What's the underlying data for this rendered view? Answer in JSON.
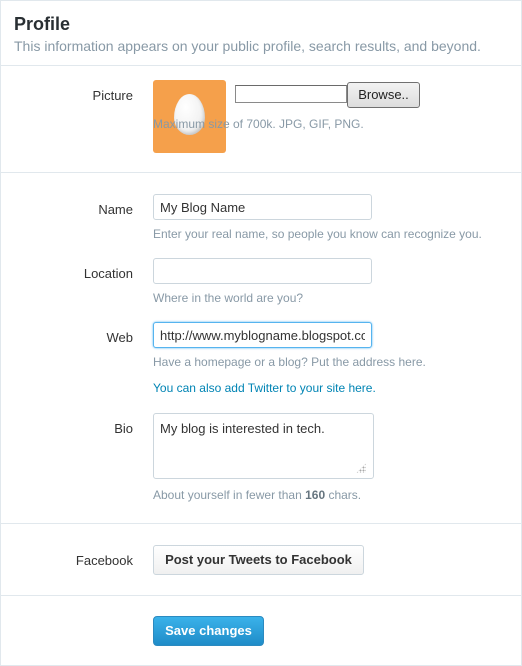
{
  "header": {
    "title": "Profile",
    "subtitle": "This information appears on your public profile, search results, and beyond."
  },
  "picture": {
    "label": "Picture",
    "browse_label": "Browse..",
    "help": "Maximum size of 700k. JPG, GIF, PNG.",
    "avatar_color": "#f5a04b",
    "avatar_icon": "egg-icon"
  },
  "name": {
    "label": "Name",
    "value": "My Blog Name",
    "help": "Enter your real name, so people you know can recognize you."
  },
  "location": {
    "label": "Location",
    "value": "",
    "help": "Where in the world are you?"
  },
  "web": {
    "label": "Web",
    "value": "http://www.myblogname.blogspot.co",
    "help": "Have a homepage or a blog? Put the address here.",
    "link": "You can also add Twitter to your site here."
  },
  "bio": {
    "label": "Bio",
    "value": "My blog is interested in tech.",
    "help_prefix": "About yourself in fewer than ",
    "help_count": "160",
    "help_suffix": " chars."
  },
  "facebook": {
    "label": "Facebook",
    "button": "Post your Tweets to Facebook"
  },
  "actions": {
    "save": "Save changes"
  },
  "colors": {
    "accent": "#1f8cc8",
    "link": "#0084b4"
  }
}
